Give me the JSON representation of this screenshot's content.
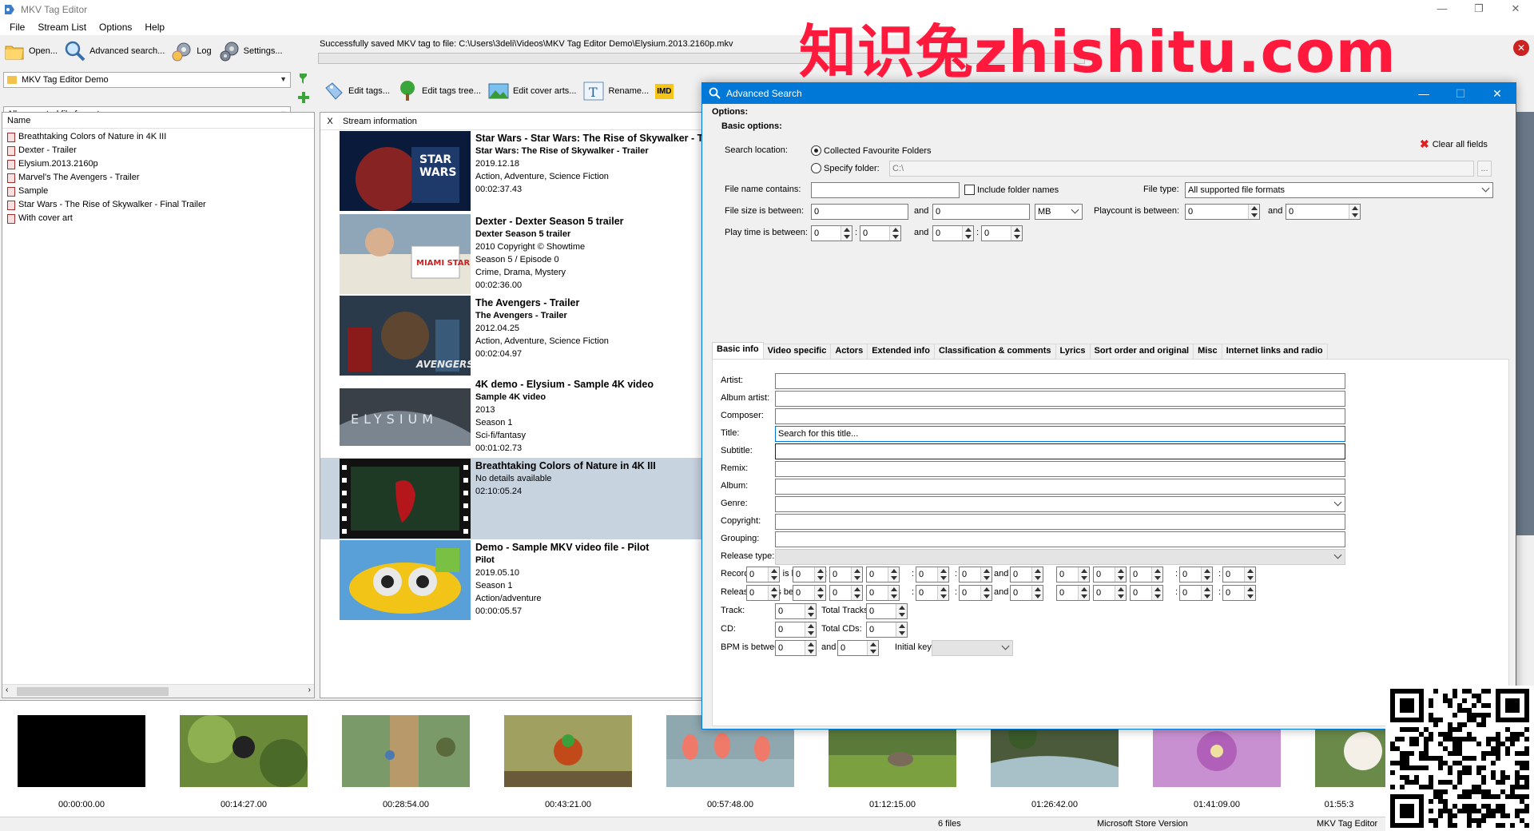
{
  "app": {
    "title": "MKV Tag Editor"
  },
  "window_buttons": {
    "minimize": "—",
    "restore": "❐",
    "close": "✕"
  },
  "menu": [
    "File",
    "Stream List",
    "Options",
    "Help"
  ],
  "toolbar": {
    "open": "Open...",
    "advanced_search": "Advanced search...",
    "log": "Log",
    "settings": "Settings..."
  },
  "status_message": "Successfully saved MKV tag to file: C:\\Users\\3deli\\Videos\\MKV Tag Editor Demo\\Elysium.2013.2160p.mkv",
  "folder_combo": {
    "value": "MKV Tag Editor Demo"
  },
  "format_combo": {
    "value": "All supported file formats"
  },
  "toolbar2": {
    "edit_tags": "Edit tags...",
    "edit_tags_tree": "Edit tags tree...",
    "edit_cover_arts": "Edit cover arts...",
    "rename": "Rename...",
    "imdb": "IMD"
  },
  "file_list": {
    "header": "Name",
    "items": [
      "Breathtaking Colors of Nature in 4K III",
      "Dexter - Trailer",
      "Elysium.2013.2160p",
      "Marvel's The Avengers - Trailer",
      "Sample",
      "Star Wars - The Rise of Skywalker - Final Trailer",
      "With cover art"
    ]
  },
  "stream_list": {
    "col_x": "X",
    "col_info": "Stream information",
    "rows": [
      {
        "title": "Star Wars - Star Wars: The Rise of Skywalker - T",
        "subtitle": "Star Wars: The Rise of Skywalker - Trailer",
        "lines": [
          "2019.12.18",
          "Action, Adventure, Science Fiction",
          "00:02:37.43"
        ],
        "selected": false
      },
      {
        "title": "Dexter - Dexter Season 5 trailer",
        "subtitle": "Dexter Season 5 trailer",
        "lines": [
          "2010 Copyright © Showtime",
          "Season 5 / Episode 0",
          "Crime, Drama, Mystery",
          "00:02:36.00"
        ],
        "selected": false
      },
      {
        "title": "The Avengers - Trailer",
        "subtitle": "The Avengers - Trailer",
        "lines": [
          "2012.04.25",
          "Action, Adventure, Science Fiction",
          "00:02:04.97"
        ],
        "selected": false
      },
      {
        "title": "4K demo - Elysium - Sample 4K video",
        "subtitle": "Sample 4K video",
        "lines": [
          "2013",
          "Season 1",
          "Sci-fi/fantasy",
          "00:01:02.73"
        ],
        "selected": false
      },
      {
        "title": "Breathtaking Colors of Nature in 4K III",
        "subtitle": "",
        "lines": [
          "No details available",
          "02:10:05.24"
        ],
        "selected": true
      },
      {
        "title": "Demo - Sample MKV video file - Pilot",
        "subtitle": "Pilot",
        "lines": [
          "2019.05.10",
          "Season 1",
          "Action/adventure",
          "00:00:05.57"
        ],
        "selected": false
      }
    ]
  },
  "filmstrip": [
    "00:00:00.00",
    "00:14:27.00",
    "00:28:54.00",
    "00:43:21.00",
    "00:57:48.00",
    "01:12:15.00",
    "01:26:42.00",
    "01:41:09.00",
    "01:55:3"
  ],
  "statusbar": {
    "files": "6 files",
    "version": "Microsoft Store Version",
    "app": "MKV Tag Editor"
  },
  "dialog": {
    "title": "Advanced Search",
    "options": "Options:",
    "basic_options": "Basic options:",
    "clear_all": "Clear all fields",
    "search_location": "Search location:",
    "collected_folders": "Collected Favourite Folders",
    "specify_folder": "Specify folder:",
    "folder_value": "C:\\",
    "browse": "...",
    "file_name_contains": "File name contains:",
    "include_folder_names": "Include folder names",
    "file_type": "File type:",
    "file_type_value": "All supported file formats",
    "file_size_between": "File size is between:",
    "and": "and",
    "size_unit": "MB",
    "playcount_between": "Playcount is between:",
    "play_time_between": "Play time is between:",
    "colon": ":",
    "zero": "0",
    "tabs": [
      "Basic info",
      "Video specific",
      "Actors",
      "Extended info",
      "Classification & comments",
      "Lyrics",
      "Sort order and original",
      "Misc",
      "Internet links and radio"
    ],
    "fields": {
      "artist": "Artist:",
      "album_artist": "Album artist:",
      "composer": "Composer:",
      "title": "Title:",
      "subtitle": "Subtitle:",
      "remix": "Remix:",
      "album": "Album:",
      "genre": "Genre:",
      "copyright": "Copyright:",
      "grouping": "Grouping:",
      "release_type": "Release type:"
    },
    "title_placeholder": "Search for this title...",
    "recording_date": "Recording date is between:",
    "release_date": "Release date is between:",
    "track": "Track:",
    "total_tracks": "Total Tracks:",
    "cd": "CD:",
    "total_cds": "Total CDs:",
    "bpm_between": "BPM is between:",
    "initial_key": "Initial key:"
  },
  "watermark": "知识兔zhishitu.com",
  "colors": {
    "accent": "#0078d7",
    "selection": "#c8d3e0",
    "watermark": "#ff1a3d"
  }
}
